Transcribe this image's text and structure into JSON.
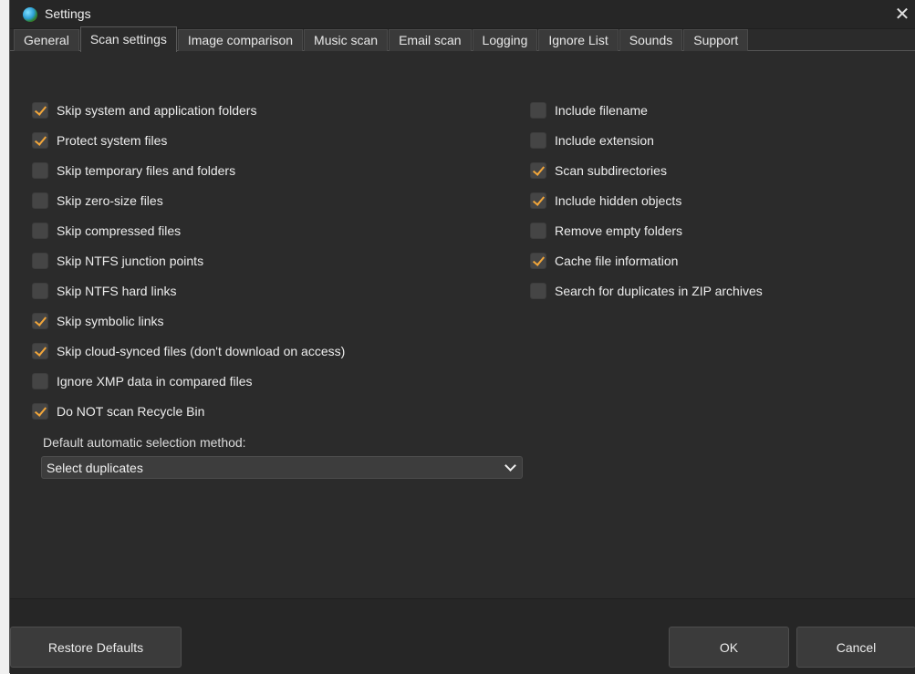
{
  "window": {
    "title": "Settings"
  },
  "tabs": [
    {
      "label": "General"
    },
    {
      "label": "Scan settings"
    },
    {
      "label": "Image comparison"
    },
    {
      "label": "Music scan"
    },
    {
      "label": "Email scan"
    },
    {
      "label": "Logging"
    },
    {
      "label": "Ignore List"
    },
    {
      "label": "Sounds"
    },
    {
      "label": "Support"
    }
  ],
  "active_tab": "Scan settings",
  "left_options": [
    {
      "label": "Skip system and application folders",
      "checked": true
    },
    {
      "label": "Protect system files",
      "checked": true
    },
    {
      "label": "Skip temporary files and folders",
      "checked": false
    },
    {
      "label": "Skip zero-size files",
      "checked": false
    },
    {
      "label": "Skip compressed files",
      "checked": false
    },
    {
      "label": "Skip NTFS junction points",
      "checked": false
    },
    {
      "label": "Skip NTFS hard links",
      "checked": false
    },
    {
      "label": "Skip symbolic links",
      "checked": true
    },
    {
      "label": "Skip cloud-synced files (don't download on access)",
      "checked": true
    },
    {
      "label": "Ignore XMP data in compared files",
      "checked": false
    },
    {
      "label": "Do NOT scan Recycle Bin",
      "checked": true
    }
  ],
  "right_options": [
    {
      "label": "Include filename",
      "checked": false
    },
    {
      "label": "Include extension",
      "checked": false
    },
    {
      "label": "Scan subdirectories",
      "checked": true
    },
    {
      "label": "Include hidden objects",
      "checked": true
    },
    {
      "label": "Remove empty folders",
      "checked": false
    },
    {
      "label": "Cache file information",
      "checked": true
    },
    {
      "label": "Search for duplicates in ZIP archives",
      "checked": false
    }
  ],
  "selection": {
    "label": "Default automatic selection method:",
    "value": "Select duplicates"
  },
  "buttons": {
    "restore": "Restore Defaults",
    "ok": "OK",
    "cancel": "Cancel"
  },
  "colors": {
    "accent_check": "#f2a63a",
    "background": "#2b2b2b"
  }
}
